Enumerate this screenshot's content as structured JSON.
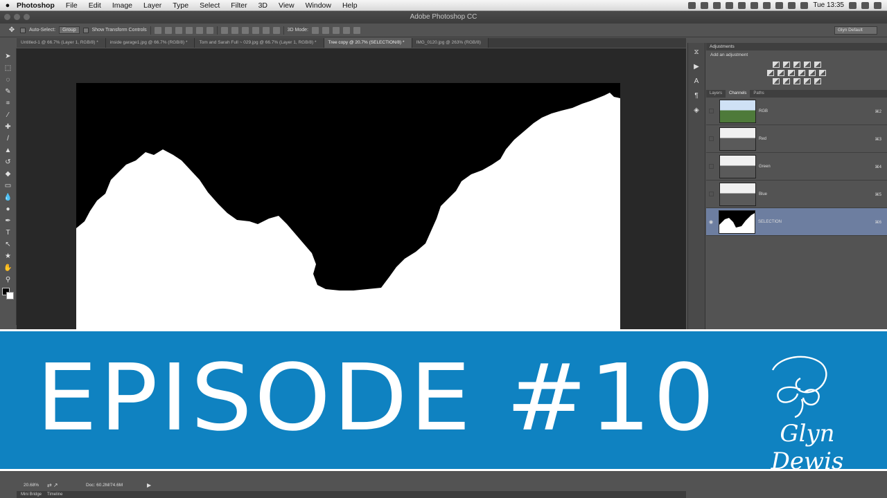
{
  "menubar": {
    "app_name": "Photoshop",
    "items": [
      "File",
      "Edit",
      "Image",
      "Layer",
      "Type",
      "Select",
      "Filter",
      "3D",
      "View",
      "Window",
      "Help"
    ],
    "clock": "Tue 13:35"
  },
  "window": {
    "title": "Adobe Photoshop CC"
  },
  "options": {
    "auto_select_label": "Auto-Select:",
    "auto_select_value": "Group",
    "transform_label": "Show Transform Controls",
    "mode_3d_label": "3D Mode:",
    "workspace": "Glyn Default"
  },
  "tabs": [
    {
      "label": "Untitled-1 @ 66.7% (Layer 1, RGB/8) *",
      "active": false
    },
    {
      "label": "inside garage1.jpg @ 66.7% (RGB/8) *",
      "active": false
    },
    {
      "label": "Tom and Sarah Full ~ 029.jpg @ 66.7% (Layer 1, RGB/8) *",
      "active": false
    },
    {
      "label": "Tree copy @ 20.7% (SELECTION/8) *",
      "active": true
    },
    {
      "label": "IMG_0120.jpg @ 263% (RGB/8)",
      "active": false
    }
  ],
  "adjustments": {
    "title": "Adjustments",
    "subtitle": "Add an adjustment"
  },
  "channel_tabs": [
    "Layers",
    "Channels",
    "Paths"
  ],
  "channels": [
    {
      "name": "RGB",
      "shortcut": "⌘2",
      "thumb": "rgb",
      "selected": false
    },
    {
      "name": "Red",
      "shortcut": "⌘3",
      "thumb": "gray",
      "selected": false
    },
    {
      "name": "Green",
      "shortcut": "⌘4",
      "thumb": "gray",
      "selected": false
    },
    {
      "name": "Blue",
      "shortcut": "⌘5",
      "thumb": "gray",
      "selected": false
    },
    {
      "name": "SELECTION",
      "shortcut": "⌘6",
      "thumb": "mask",
      "selected": true
    }
  ],
  "status": {
    "zoom": "20.68%",
    "doc": "Doc: 60.2M/74.6M"
  },
  "bottom_tabs": [
    "Mini Bridge",
    "Timeline"
  ],
  "banner": {
    "title": "EPISODE #10",
    "brand": "Glyn Dewis",
    "color": "#0f82c1"
  }
}
